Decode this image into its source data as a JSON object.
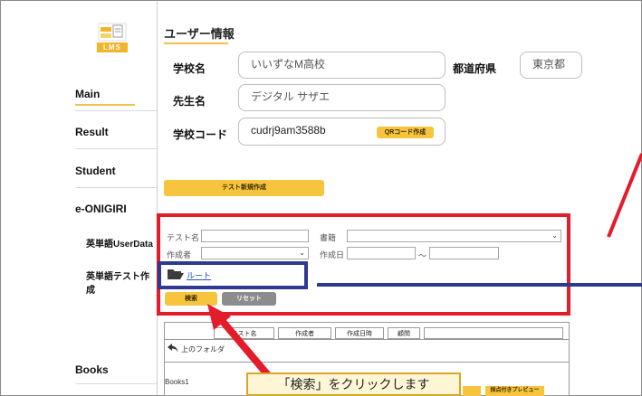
{
  "sidebar": {
    "logo_text": "LMS",
    "nav_main": "Main",
    "nav_result": "Result",
    "nav_student": "Student",
    "nav_onigiri": "e-ONIGIRI",
    "sub_userdata": "英単語UserData",
    "sub_test": "英単語テスト作成",
    "nav_books": "Books"
  },
  "user_info": {
    "title": "ユーザー情報",
    "school_label": "学校名",
    "school_value": "いいずなM高校",
    "pref_label": "都道府県",
    "pref_value": "東京都",
    "teacher_label": "先生名",
    "teacher_value": "デジタル サザエ",
    "code_label": "学校コード",
    "code_value": "cudrj9am3588b",
    "qr_button": "QRコード作成"
  },
  "new_test_button": "テスト新規作成",
  "search": {
    "test_name_label": "テスト名",
    "book_label": "書籍",
    "author_label": "作成者",
    "date_label": "作成日",
    "tilde": "〜",
    "root_link": "ルート",
    "search_button": "検索",
    "reset_button": "リセット"
  },
  "table": {
    "col_name": "テスト名",
    "col_author": "作成者",
    "col_date": "作成日時",
    "col_count": "顧問",
    "up_folder": "上のフォルダ",
    "row1_name": "Books1",
    "preview_button": "採点付きプレビュー"
  },
  "annotation": {
    "callout_text": "「検索」をクリックします"
  },
  "colors": {
    "accent_yellow": "#f6c43d",
    "annotation_red": "#e41b2a",
    "annotation_blue": "#2e3a8f"
  }
}
